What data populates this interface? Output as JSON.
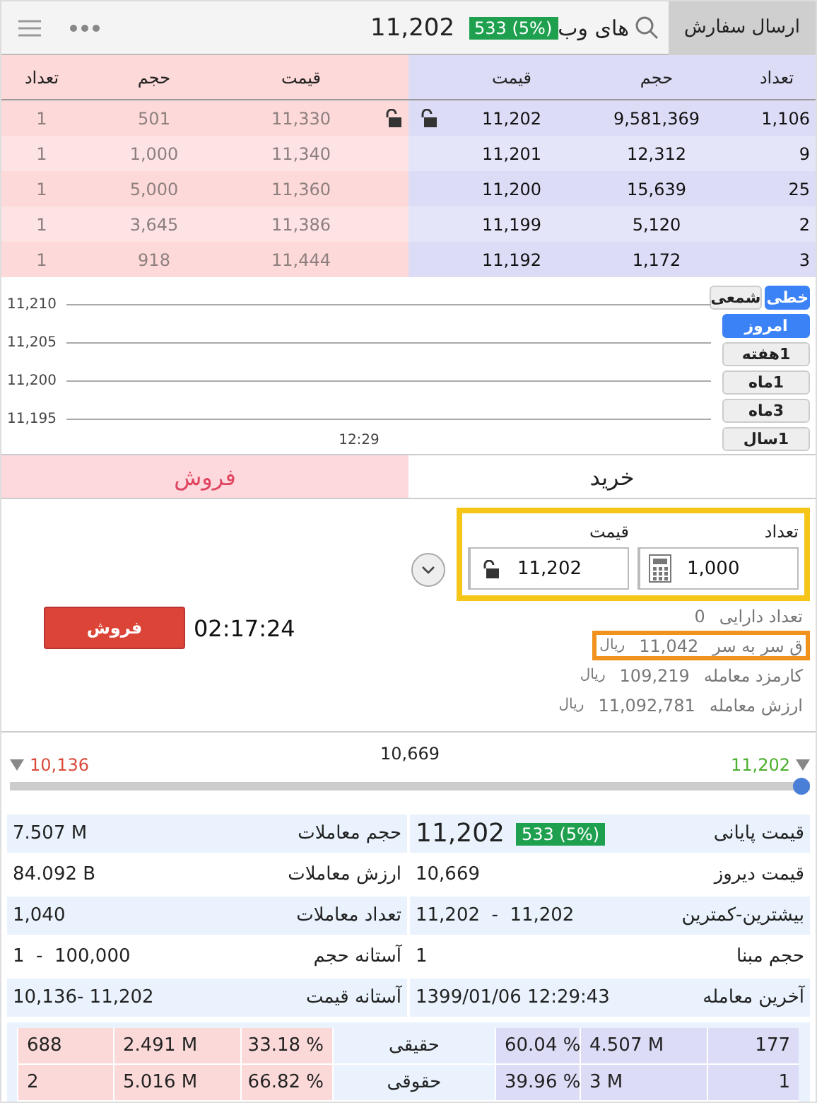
{
  "header": {
    "order_button": "ارسال سفارش",
    "symbol": "های وب",
    "change_badge": "533 (5%)",
    "price": "11,202"
  },
  "order_book": {
    "buy_columns": [
      "تعداد",
      "حجم",
      "قیمت"
    ],
    "sell_columns": [
      "قیمت",
      "حجم",
      "تعداد"
    ],
    "rows": [
      {
        "buy": [
          "1,106",
          "9,581,369",
          "11,202"
        ],
        "sell": [
          "11,330",
          "501",
          "1"
        ],
        "unlock_icon": true
      },
      {
        "buy": [
          "9",
          "12,312",
          "11,201"
        ],
        "sell": [
          "11,340",
          "1,000",
          "1"
        ],
        "unlock_icon": false
      },
      {
        "buy": [
          "25",
          "15,639",
          "11,200"
        ],
        "sell": [
          "11,360",
          "5,000",
          "1"
        ],
        "unlock_icon": false
      },
      {
        "buy": [
          "2",
          "5,120",
          "11,199"
        ],
        "sell": [
          "11,386",
          "3,645",
          "1"
        ],
        "unlock_icon": false
      },
      {
        "buy": [
          "3",
          "1,172",
          "11,192"
        ],
        "sell": [
          "11,444",
          "918",
          "1"
        ],
        "unlock_icon": false
      }
    ]
  },
  "chart": {
    "y_labels": [
      "11,210",
      "11,205",
      "11,200",
      "11,195"
    ],
    "x_label": "12:29",
    "chart_types": [
      {
        "label": "خطی",
        "selected": true
      },
      {
        "label": "شمعی",
        "selected": false
      }
    ],
    "periods": [
      {
        "label": "امروز",
        "selected": true
      },
      {
        "label": "1هفته",
        "selected": false
      },
      {
        "label": "1ماه",
        "selected": false
      },
      {
        "label": "3ماه",
        "selected": false
      },
      {
        "label": "1سال",
        "selected": false
      }
    ]
  },
  "side_tabs": [
    {
      "label": "خرید",
      "selected": false
    },
    {
      "label": "فروش",
      "selected": true
    }
  ],
  "order_form": {
    "quantity_label": "تعداد",
    "price_label": "قیمت",
    "quantity": "1,000",
    "price": "11,202",
    "inputs_highlighted": true,
    "info": [
      {
        "label": "تعداد دارایی",
        "value": "0",
        "highlighted": false
      },
      {
        "label": "ق سر به سر",
        "value": "11,042",
        "unit": "ریال",
        "highlighted": true
      },
      {
        "label": "کارمزد معامله",
        "value": "109,219",
        "unit": "ریال",
        "highlighted": false
      },
      {
        "label": "ارزش معامله",
        "value": "11,092,781",
        "unit": "ریال",
        "highlighted": false
      }
    ],
    "timer": "02:17:24",
    "submit": "فروش"
  },
  "price_range": {
    "low": "10,136",
    "mid": "10,669",
    "high": "11,202",
    "level": 1
  },
  "stats": [
    {
      "label": "قیمت پایانی",
      "value": "11,202",
      "badge": "533 (5%)",
      "label_2": "حجم معاملات",
      "value_2": "7.507 M"
    },
    {
      "label": "قیمت دیروز",
      "value": "10,669",
      "label_2": "ارزش معاملات",
      "value_2": "84.092 B"
    },
    {
      "label": "بیشترین-کمترین",
      "value": "11,202  -  11,202",
      "label_2": "تعداد معاملات",
      "value_2": "1,040"
    },
    {
      "label": "حجم مبنا",
      "value": "1",
      "label_2": "آستانه حجم",
      "value_2": "1  -  100,000"
    },
    {
      "label": "آخرین معامله",
      "value": "1399/01/06 12:29:43",
      "label_2": "آستانه قیمت",
      "value_2": "10,136- 11,202"
    }
  ],
  "holders": [
    {
      "buy": [
        "177",
        "4.507 M",
        "60.04 %"
      ],
      "type": "حقیقی",
      "sell": [
        "33.18 %",
        "2.491 M",
        "688"
      ]
    },
    {
      "buy": [
        "1",
        "3 M",
        "39.96 %"
      ],
      "type": "حقوقی",
      "sell": [
        "66.82 %",
        "5.016 M",
        "2"
      ]
    }
  ]
}
